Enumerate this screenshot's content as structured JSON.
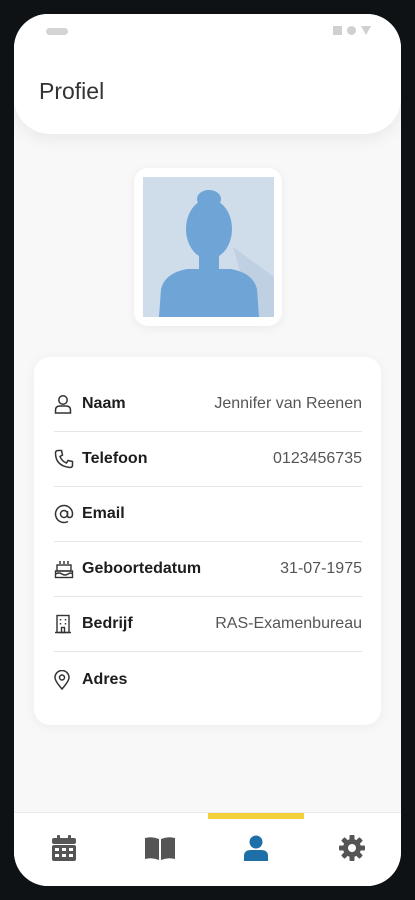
{
  "header": {
    "title": "Profiel"
  },
  "avatar": {
    "icon": "user-silhouette-icon",
    "background": "#cfdcea",
    "figure_color": "#6fa5d6"
  },
  "profile": {
    "rows": [
      {
        "icon": "person-icon",
        "label": "Naam",
        "value": "Jennifer van Reenen"
      },
      {
        "icon": "phone-icon",
        "label": "Telefoon",
        "value": "0123456735"
      },
      {
        "icon": "at-sign-icon",
        "label": "Email",
        "value": ""
      },
      {
        "icon": "cake-icon",
        "label": "Geboortedatum",
        "value": "31-07-1975"
      },
      {
        "icon": "building-icon",
        "label": "Bedrijf",
        "value": "RAS-Examenbureau"
      },
      {
        "icon": "location-pin-icon",
        "label": "Adres",
        "value": ""
      }
    ]
  },
  "bottom_nav": {
    "active": "profile",
    "accent_color": "#1e6fa8",
    "indicator_color": "#f2cf3b",
    "items": [
      {
        "name": "calendar",
        "icon": "calendar-icon"
      },
      {
        "name": "book",
        "icon": "book-icon"
      },
      {
        "name": "profile",
        "icon": "user-icon"
      },
      {
        "name": "settings",
        "icon": "gear-icon"
      }
    ]
  }
}
